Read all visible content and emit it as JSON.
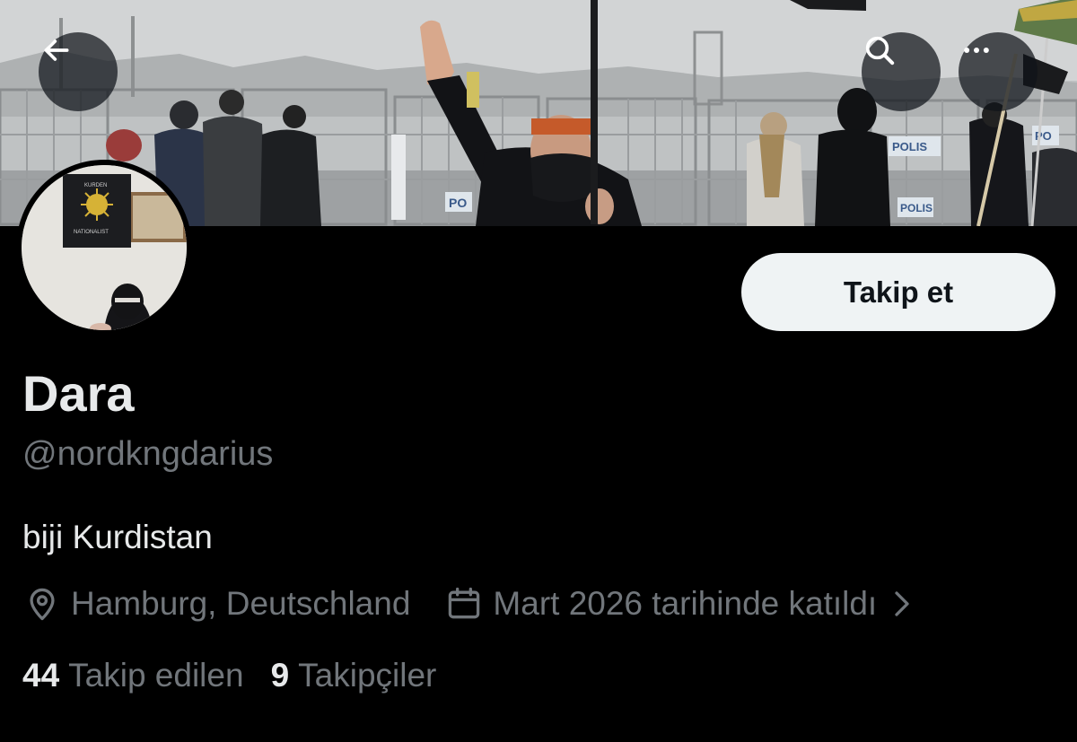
{
  "banner": {
    "badge_text": "PO",
    "badge_text_2": "POLIS",
    "badge_text_3": "POLIS",
    "badge_text_4": "PO"
  },
  "nav": {
    "back_icon": "arrow-left-icon",
    "search_icon": "search-icon",
    "more_icon": "more-horizontal-icon"
  },
  "avatar": {
    "flag_text_top": "KURDEN",
    "flag_text_bottom": "NATIONALIST"
  },
  "actions": {
    "follow_label": "Takip et"
  },
  "profile": {
    "display_name": "Dara",
    "handle": "@nordkngdarius",
    "bio": "biji Kurdistan",
    "location": "Hamburg, Deutschland",
    "location_icon": "location-pin-icon",
    "joined": "Mart 2026 tarihinde katıldı",
    "joined_icon": "calendar-icon",
    "following_count": "44",
    "following_label": "Takip edilen",
    "followers_count": "9",
    "followers_label": "Takipçiler"
  },
  "colors": {
    "background": "#000000",
    "primary_text": "#e7e9ea",
    "secondary_text": "#71767b",
    "follow_button_bg": "#eff3f4",
    "follow_button_text": "#0f1419"
  }
}
